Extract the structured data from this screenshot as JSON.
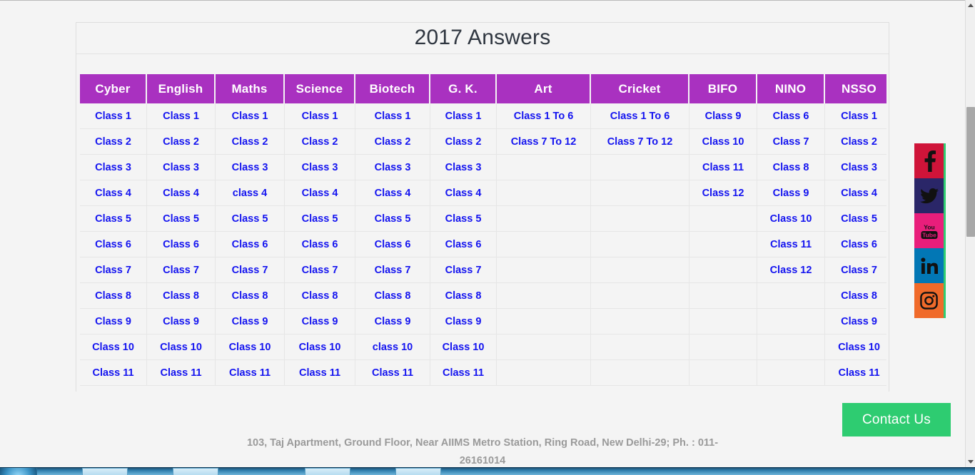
{
  "page": {
    "title": "2017 Answers",
    "footer_address": "103, Taj Apartment, Ground Floor, Near AIIMS Metro Station, Ring Road, New Delhi-29; Ph. : 011-26161014",
    "contact_button_label": "Contact Us",
    "accent_header_color": "#a931c0",
    "link_text_color": "#1414f0",
    "contact_button_color": "#2ecc71",
    "page_background": "#f4f4f4"
  },
  "table": {
    "columns": [
      "Cyber",
      "English",
      "Maths",
      "Science",
      "Biotech",
      "G. K.",
      "Art",
      "Cricket",
      "BIFO",
      "NINO",
      "NSSO"
    ],
    "rows": [
      [
        "Class 1",
        "Class 1",
        "Class 1",
        "Class 1",
        "Class 1",
        "Class 1",
        "Class 1 To 6",
        "Class 1 To 6",
        "Class 9",
        "Class 6",
        "Class 1"
      ],
      [
        "Class 2",
        "Class 2",
        "Class 2",
        "Class 2",
        "Class 2",
        "Class 2",
        "Class 7 To 12",
        "Class 7 To 12",
        "Class 10",
        "Class 7",
        "Class 2"
      ],
      [
        "Class 3",
        "Class 3",
        "Class 3",
        "Class 3",
        "Class 3",
        "Class 3",
        "",
        "",
        "Class 11",
        "Class 8",
        "Class 3"
      ],
      [
        "Class 4",
        "Class 4",
        "class 4",
        "Class 4",
        "Class 4",
        "Class 4",
        "",
        "",
        "Class 12",
        "Class 9",
        "Class 4"
      ],
      [
        "Class 5",
        "Class 5",
        "Class 5",
        "Class 5",
        "Class 5",
        "Class 5",
        "",
        "",
        "",
        "Class 10",
        "Class 5"
      ],
      [
        "Class 6",
        "Class 6",
        "Class 6",
        "Class 6",
        "Class 6",
        "Class 6",
        "",
        "",
        "",
        "Class 11",
        "Class 6"
      ],
      [
        "Class 7",
        "Class 7",
        "Class 7",
        "Class 7",
        "Class 7",
        "Class 7",
        "",
        "",
        "",
        "Class 12",
        "Class 7"
      ],
      [
        "Class 8",
        "Class 8",
        "Class 8",
        "Class 8",
        "Class 8",
        "Class 8",
        "",
        "",
        "",
        "",
        "Class 8"
      ],
      [
        "Class 9",
        "Class 9",
        "Class 9",
        "Class 9",
        "Class 9",
        "Class 9",
        "",
        "",
        "",
        "",
        "Class 9"
      ],
      [
        "Class 10",
        "Class 10",
        "Class 10",
        "Class 10",
        "class 10",
        "Class 10",
        "",
        "",
        "",
        "",
        "Class 10"
      ],
      [
        "Class 11",
        "Class 11",
        "Class 11",
        "Class 11",
        "Class 11",
        "Class 11",
        "",
        "",
        "",
        "",
        "Class 11"
      ]
    ]
  },
  "social": {
    "items": [
      {
        "name": "facebook",
        "icon": "facebook-icon",
        "color": "#cf1439"
      },
      {
        "name": "twitter",
        "icon": "twitter-icon",
        "color": "#2a2668"
      },
      {
        "name": "youtube",
        "icon": "youtube-icon",
        "color": "#e91e7b"
      },
      {
        "name": "linkedin",
        "icon": "linkedin-icon",
        "color": "#0277b5"
      },
      {
        "name": "instagram",
        "icon": "instagram-icon",
        "color": "#f06a2a"
      }
    ],
    "rail_accent": "#2ecc71"
  },
  "scrollbar": {
    "up_arrow": "scroll-up-arrow",
    "down_arrow": "scroll-down-arrow"
  }
}
